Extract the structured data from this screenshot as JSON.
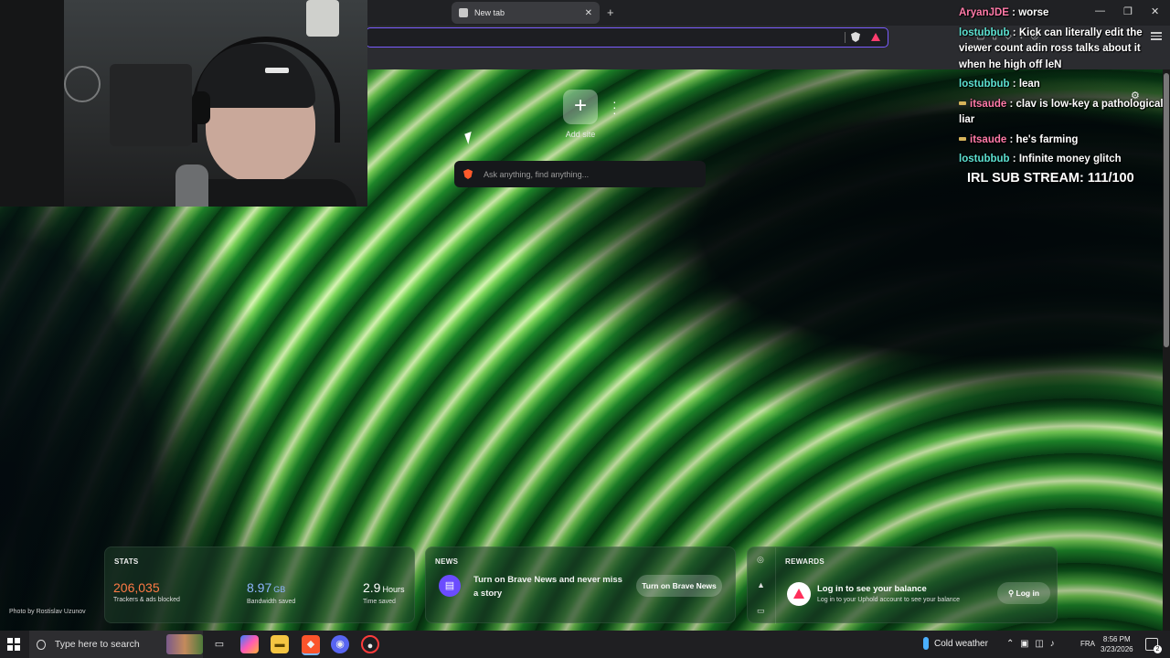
{
  "browser": {
    "tab_title": "New tab",
    "tab_close": "✕",
    "new_tab": "+",
    "controls": {
      "minimize": "—",
      "restore": "❐",
      "close": "✕"
    }
  },
  "ntp": {
    "add_site_icon": "+",
    "add_site_label": "Add site",
    "search_placeholder": "Ask anything, find anything...",
    "photo_credit": "Photo by Rostislav Uzunov",
    "settings_icon": "⚙",
    "stats": {
      "title": "STATS",
      "trackers_value": "206,035",
      "trackers_label": "Trackers & ads blocked",
      "bandwidth_value": "8.97",
      "bandwidth_unit": "GB",
      "bandwidth_label": "Bandwidth saved",
      "time_value": "2.9",
      "time_unit": "Hours",
      "time_label": "Time saved",
      "colors": {
        "trackers": "#ff7a45",
        "bandwidth": "#8fb5ff",
        "time": "#ffffff"
      }
    },
    "news": {
      "title": "NEWS",
      "icon": "▤",
      "text": "Turn on Brave News and never miss a story",
      "button": "Turn on Brave News"
    },
    "rewards": {
      "title": "REWARDS",
      "heading": "Log in to see your balance",
      "subtext": "Log in to your Uphold account to see your balance",
      "button": "⚲ Log in",
      "side_icons": [
        "◎",
        "▲",
        "▭"
      ]
    }
  },
  "chat": {
    "messages": [
      {
        "user": "AryanJDE",
        "sep": " : ",
        "text": "worse",
        "color": "pink"
      },
      {
        "user": "lostubbub",
        "sep": " : ",
        "text": "Kick can literally edit the viewer count adin ross talks about it when he high off leN",
        "color": "teal"
      },
      {
        "user": "lostubbub",
        "sep": " : ",
        "text": "lean",
        "color": "teal"
      },
      {
        "user": "itsaude",
        "sep": " : ",
        "text": "clav is low-key a pathological liar",
        "color": "pink"
      },
      {
        "user": "itsaude",
        "sep": " : ",
        "text": "he's farming",
        "color": "pink"
      },
      {
        "user": "lostubbub",
        "sep": " : ",
        "text": "Infinite money glitch",
        "color": "teal"
      }
    ],
    "sub_goal": "IRL SUB STREAM: 111/100"
  },
  "taskbar": {
    "search_placeholder": "Type here to search",
    "weather": "Cold weather",
    "language": "FRA",
    "time": "8:56 PM",
    "date": "3/23/2026",
    "notifications": "2",
    "tray_icons": "⌃  ▣  ◫  ♪"
  }
}
